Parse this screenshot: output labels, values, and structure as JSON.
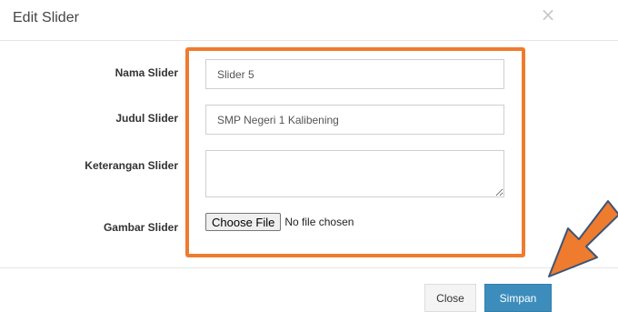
{
  "modal": {
    "title": "Edit Slider",
    "close_icon": "×"
  },
  "form": {
    "nama_label": "Nama Slider",
    "nama_value": "Slider 5",
    "judul_label": "Judul Slider",
    "judul_value": "SMP Negeri 1 Kalibening",
    "keterangan_label": "Keterangan Slider",
    "keterangan_value": "",
    "gambar_label": "Gambar Slider",
    "file_button_label": "Choose File",
    "file_status": "No file chosen"
  },
  "footer": {
    "close_label": "Close",
    "save_label": "Simpan"
  },
  "colors": {
    "highlight": "#ef7b2e",
    "primary_button": "#3c8dbc"
  },
  "icons": {
    "close": "close-icon",
    "annotation": "orange-arrow-icon"
  }
}
